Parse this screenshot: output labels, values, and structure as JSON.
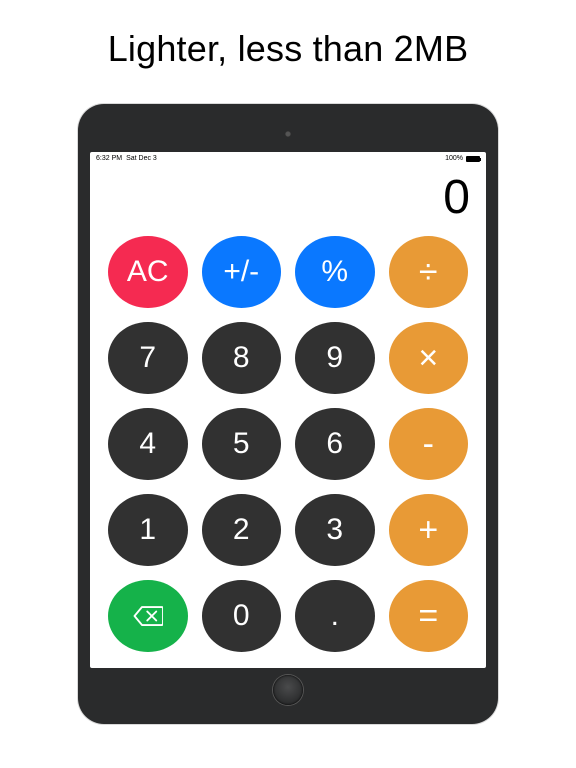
{
  "headline": "Lighter, less than 2MB",
  "status": {
    "time": "6:32 PM",
    "date": "Sat Dec 3",
    "battery": "100%"
  },
  "display": {
    "value": "0"
  },
  "keys": {
    "ac": "AC",
    "sign": "+/-",
    "percent": "%",
    "divide": "÷",
    "k7": "7",
    "k8": "8",
    "k9": "9",
    "multiply": "×",
    "k4": "4",
    "k5": "5",
    "k6": "6",
    "minus": "-",
    "k1": "1",
    "k2": "2",
    "k3": "3",
    "plus": "+",
    "k0": "0",
    "dot": ".",
    "equals": "="
  }
}
